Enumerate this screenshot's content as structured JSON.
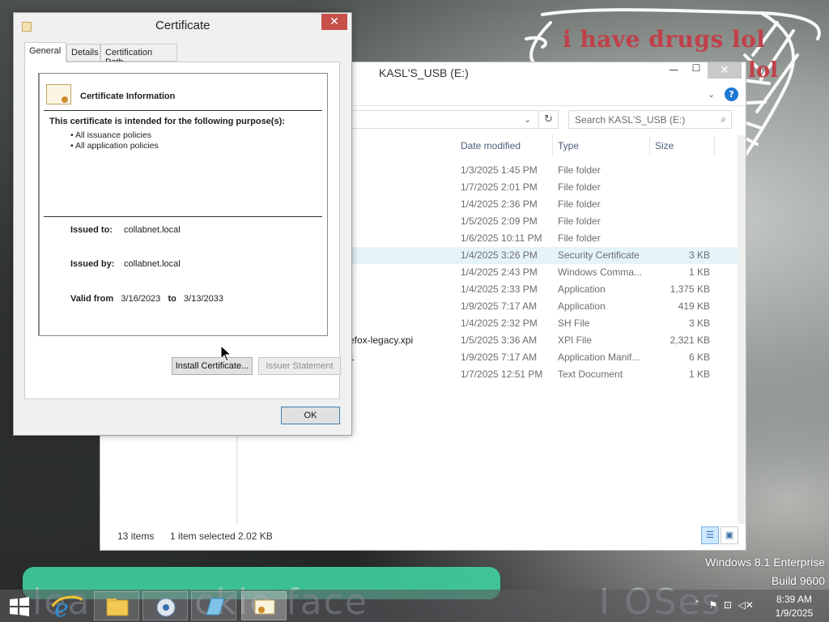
{
  "desktop": {
    "overlay_text": "i have drugs lol",
    "overlay_text2": "lol",
    "background_text": "lea",
    "background_text_rest": "ckie face",
    "background_text2": "I OSes",
    "os_name": "Windows 8.1 Enterprise",
    "build": "Build 9600"
  },
  "explorer": {
    "title": "KASL'S_USB (E:)",
    "search_placeholder": "Search KASL'S_USB (E:)",
    "columns": {
      "date": "Date modified",
      "type": "Type",
      "size": "Size"
    },
    "rows": [
      {
        "name": "",
        "date": "1/3/2025 1:45 PM",
        "type": "File folder",
        "size": ""
      },
      {
        "name": "",
        "date": "1/7/2025 2:01 PM",
        "type": "File folder",
        "size": ""
      },
      {
        "name": "",
        "date": "1/4/2025 2:36 PM",
        "type": "File folder",
        "size": ""
      },
      {
        "name": "",
        "date": "1/5/2025 2:09 PM",
        "type": "File folder",
        "size": ""
      },
      {
        "name": "",
        "date": "1/6/2025 10:11 PM",
        "type": "File folder",
        "size": ""
      },
      {
        "name": "",
        "date": "1/4/2025 3:26 PM",
        "type": "Security Certificate",
        "size": "3 KB",
        "selected": true
      },
      {
        "name": "",
        "date": "1/4/2025 2:43 PM",
        "type": "Windows Comma...",
        "size": "1 KB"
      },
      {
        "name": "",
        "date": "1/4/2025 2:33 PM",
        "type": "Application",
        "size": "1,375 KB"
      },
      {
        "name": "",
        "date": "1/9/2025 7:17 AM",
        "type": "Application",
        "size": "419 KB"
      },
      {
        "name": "",
        "date": "1/4/2025 2:32 PM",
        "type": "SH File",
        "size": "3 KB"
      },
      {
        "name": "efox-legacy.xpi",
        "date": "1/5/2025 3:36 AM",
        "type": "XPI File",
        "size": "2,321 KB"
      },
      {
        "name": "1",
        "date": "1/9/2025 7:17 AM",
        "type": "Application Manif...",
        "size": "6 KB"
      },
      {
        "name": "",
        "date": "1/7/2025 12:51 PM",
        "type": "Text Document",
        "size": "1 KB"
      }
    ],
    "status_count": "13 items",
    "status_selection": "1 item selected  2.02 KB",
    "help_label": "?"
  },
  "certificate": {
    "title": "Certificate",
    "tabs": [
      "General",
      "Details",
      "Certification Path"
    ],
    "info_title": "Certificate Information",
    "purpose_title": "This certificate is intended for the following purpose(s):",
    "purposes": [
      "• All issuance policies",
      "• All application policies"
    ],
    "issued_to_label": "Issued to:",
    "issued_to": "collabnet.local",
    "issued_by_label": "Issued by:",
    "issued_by": "collabnet.local",
    "valid_from_label": "Valid from",
    "valid_from": "3/16/2023",
    "valid_to_label": "to",
    "valid_to": "3/13/2033",
    "install_button": "Install Certificate...",
    "issuer_button": "Issuer Statement",
    "ok_button": "OK"
  },
  "taskbar": {
    "time": "8:39 AM",
    "date": "1/9/2025"
  },
  "colors": {
    "accent": "#1e78d2",
    "selection": "#e5f3fb",
    "close_red": "#c7504a",
    "overlay_red": "#c0404a"
  }
}
